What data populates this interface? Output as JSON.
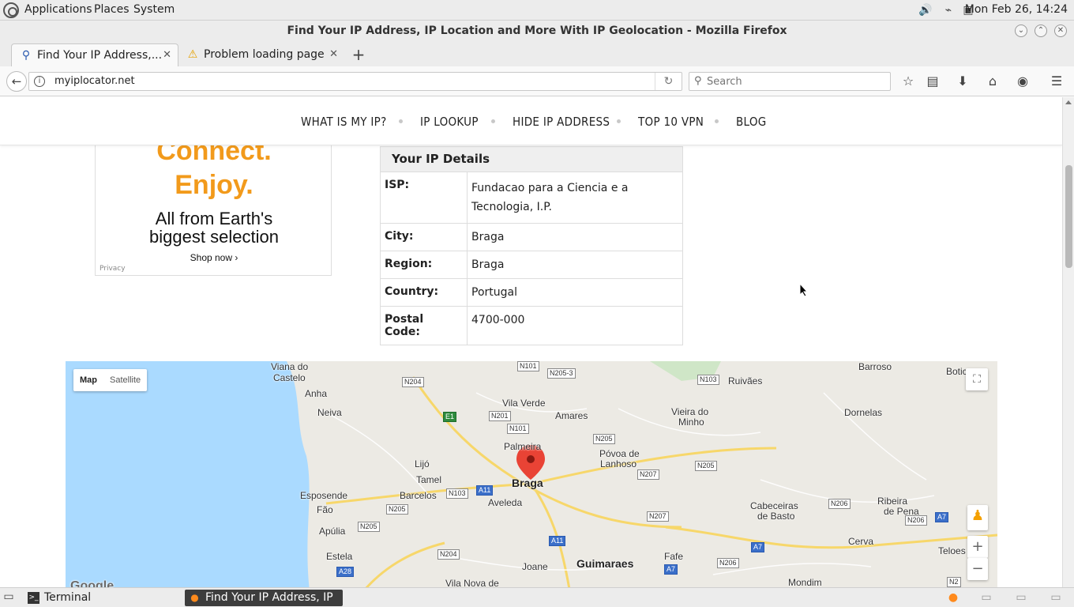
{
  "top_panel": {
    "menus": [
      "Applications",
      "Places",
      "System"
    ],
    "clock": "Mon Feb 26, 14:24"
  },
  "window": {
    "title": "Find Your IP Address, IP Location and More With IP Geolocation - Mozilla Firefox"
  },
  "tabs": [
    {
      "label": "Find Your IP Address,...",
      "icon": "location-pin-icon"
    },
    {
      "label": "Problem loading page",
      "icon": "warning-icon"
    }
  ],
  "navbar": {
    "url": "myiplocator.net",
    "search_placeholder": "Search"
  },
  "site_nav": [
    "WHAT IS MY IP?",
    "IP LOOKUP",
    "HIDE IP ADDRESS",
    "TOP 10 VPN",
    "BLOG"
  ],
  "ad": {
    "line1": "Connect.",
    "line2": "Enjoy.",
    "tagline1": "All from Earth's",
    "tagline2": "biggest selection",
    "shop": "Shop now ›",
    "privacy": "Privacy"
  },
  "details": {
    "heading": "Your IP Details",
    "rows": [
      {
        "key": "ISP:",
        "value": "Fundacao para a Ciencia e a Tecnologia, I.P."
      },
      {
        "key": "City:",
        "value": "Braga"
      },
      {
        "key": "Region:",
        "value": "Braga"
      },
      {
        "key": "Country:",
        "value": "Portugal"
      },
      {
        "key": "Postal Code:",
        "value": "4700-000"
      }
    ]
  },
  "map": {
    "type_buttons": [
      "Map",
      "Satellite"
    ],
    "places": [
      "Viana do",
      "Castelo",
      "Anha",
      "Neiva",
      "Esposende",
      "Fão",
      "Apúlia",
      "Estela",
      "Lijó",
      "Tamel",
      "Barcelos",
      "Vila Verde",
      "Amares",
      "Palmeira",
      "Braga",
      "Aveleda",
      "Póvoa de",
      "Lanhoso",
      "Vieira do",
      "Minho",
      "Ruivães",
      "Barroso",
      "Dornelas",
      "Cabeceiras",
      "de Basto",
      "Ribeira",
      "de Pena",
      "Cerva",
      "Fafe",
      "Guimaraes",
      "Joane",
      "Vila Nova de",
      "Mondim",
      "Teloes",
      "Botic"
    ],
    "roads": [
      "N101",
      "N205-3",
      "N204",
      "N103",
      "E1",
      "N201",
      "N101",
      "N205",
      "N207",
      "N205",
      "N103",
      "A11",
      "N205",
      "N205",
      "N207",
      "N206",
      "N206",
      "A7",
      "N204",
      "A11",
      "A28",
      "A7",
      "N206",
      "A7",
      "N2"
    ],
    "zoom_in": "+",
    "zoom_out": "−",
    "logo": "Google"
  },
  "taskbar": {
    "terminal": "Terminal",
    "firefox": "Find Your IP Address, IP ..."
  }
}
